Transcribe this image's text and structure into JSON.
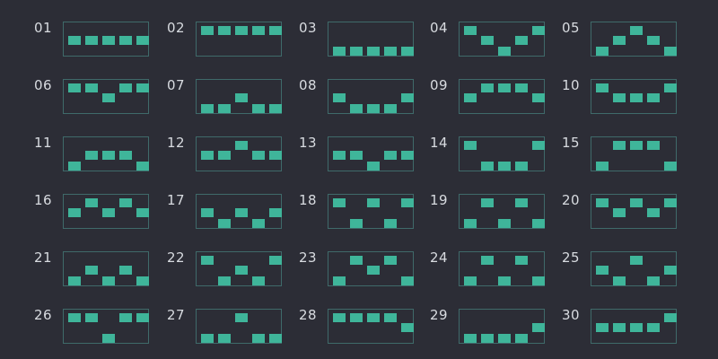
{
  "paylines": [
    {
      "number": "01",
      "rows": [
        1,
        1,
        1,
        1,
        1
      ]
    },
    {
      "number": "02",
      "rows": [
        0,
        0,
        0,
        0,
        0
      ]
    },
    {
      "number": "03",
      "rows": [
        2,
        2,
        2,
        2,
        2
      ]
    },
    {
      "number": "04",
      "rows": [
        0,
        1,
        2,
        1,
        0
      ]
    },
    {
      "number": "05",
      "rows": [
        2,
        1,
        0,
        1,
        2
      ]
    },
    {
      "number": "06",
      "rows": [
        0,
        0,
        1,
        0,
        0
      ]
    },
    {
      "number": "07",
      "rows": [
        2,
        2,
        1,
        2,
        2
      ]
    },
    {
      "number": "08",
      "rows": [
        1,
        2,
        2,
        2,
        1
      ]
    },
    {
      "number": "09",
      "rows": [
        1,
        0,
        0,
        0,
        1
      ]
    },
    {
      "number": "10",
      "rows": [
        0,
        1,
        1,
        1,
        0
      ]
    },
    {
      "number": "11",
      "rows": [
        2,
        1,
        1,
        1,
        2
      ]
    },
    {
      "number": "12",
      "rows": [
        1,
        1,
        0,
        1,
        1
      ]
    },
    {
      "number": "13",
      "rows": [
        1,
        1,
        2,
        1,
        1
      ]
    },
    {
      "number": "14",
      "rows": [
        0,
        2,
        2,
        2,
        0
      ]
    },
    {
      "number": "15",
      "rows": [
        2,
        0,
        0,
        0,
        2
      ]
    },
    {
      "number": "16",
      "rows": [
        1,
        0,
        1,
        0,
        1
      ]
    },
    {
      "number": "17",
      "rows": [
        1,
        2,
        1,
        2,
        1
      ]
    },
    {
      "number": "18",
      "rows": [
        0,
        2,
        0,
        2,
        0
      ]
    },
    {
      "number": "19",
      "rows": [
        2,
        0,
        2,
        0,
        2
      ]
    },
    {
      "number": "20",
      "rows": [
        0,
        1,
        0,
        1,
        0
      ]
    },
    {
      "number": "21",
      "rows": [
        2,
        1,
        2,
        1,
        2
      ]
    },
    {
      "number": "22",
      "rows": [
        0,
        2,
        1,
        2,
        0
      ]
    },
    {
      "number": "23",
      "rows": [
        2,
        0,
        1,
        0,
        2
      ]
    },
    {
      "number": "24",
      "rows": [
        2,
        0,
        2,
        0,
        2
      ]
    },
    {
      "number": "25",
      "rows": [
        1,
        2,
        0,
        2,
        1
      ]
    },
    {
      "number": "26",
      "rows": [
        0,
        0,
        2,
        0,
        0
      ]
    },
    {
      "number": "27",
      "rows": [
        2,
        2,
        0,
        2,
        2
      ]
    },
    {
      "number": "28",
      "rows": [
        0,
        0,
        0,
        0,
        1
      ]
    },
    {
      "number": "29",
      "rows": [
        2,
        2,
        2,
        2,
        1
      ]
    },
    {
      "number": "30",
      "rows": [
        1,
        1,
        1,
        1,
        0
      ]
    }
  ],
  "colors": {
    "background": "#2c2d36",
    "symbol": "#3fb59a",
    "frame": "#3f6a6a",
    "label": "#d8dbe0"
  }
}
